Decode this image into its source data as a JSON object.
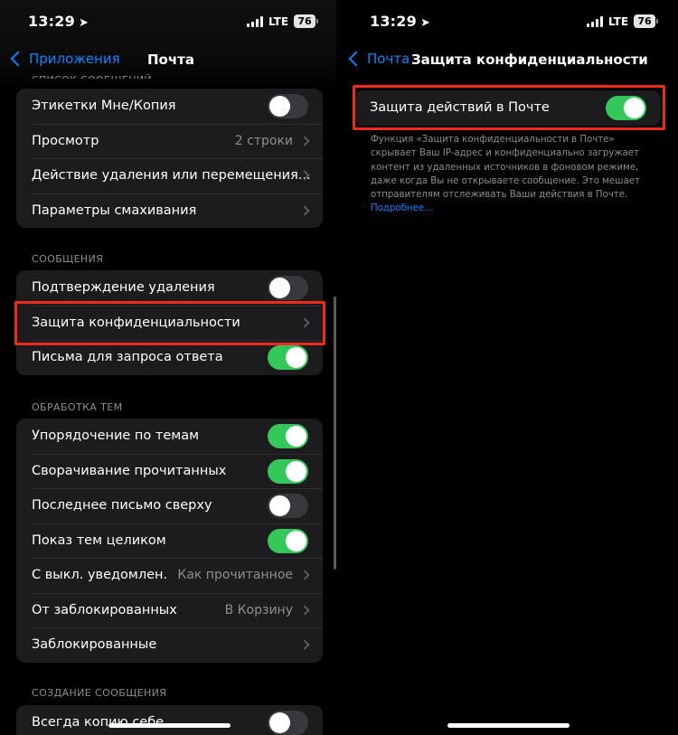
{
  "left": {
    "status": {
      "time": "13:29",
      "network": "LTE",
      "battery": "76"
    },
    "nav": {
      "back_label": "Приложения",
      "title": "Почта"
    },
    "cut_header": "СПИСОК СООБЩЕНИЙ",
    "list_group": [
      {
        "label": "Этикетки Мне/Копия",
        "toggle": false
      },
      {
        "label": "Просмотр",
        "value": "2 строки"
      },
      {
        "label": "Действие удаления или перемещения..."
      },
      {
        "label": "Параметры смахивания"
      }
    ],
    "messages_header": "СООБЩЕНИЯ",
    "messages_group": [
      {
        "label": "Подтверждение удаления",
        "toggle": false
      },
      {
        "label": "Защита конфиденциальности"
      },
      {
        "label": "Письма для запроса ответа",
        "toggle": true
      }
    ],
    "threads_header": "ОБРАБОТКА ТЕМ",
    "threads_group": [
      {
        "label": "Упорядочение по темам",
        "toggle": true
      },
      {
        "label": "Сворачивание прочитанных",
        "toggle": true
      },
      {
        "label": "Последнее письмо сверху",
        "toggle": false
      },
      {
        "label": "Показ тем целиком",
        "toggle": true
      },
      {
        "label": "С выкл. уведомлен.",
        "value": "Как прочитанное"
      },
      {
        "label": "От заблокированных",
        "value": "В Корзину"
      },
      {
        "label": "Заблокированные"
      }
    ],
    "compose_header": "СОЗДАНИЕ СООБЩЕНИЯ",
    "compose_group": [
      {
        "label": "Всегда копию себе",
        "toggle": false
      }
    ]
  },
  "right": {
    "status": {
      "time": "13:29",
      "network": "LTE",
      "battery": "76"
    },
    "nav": {
      "back_label": "Почта",
      "title": "Защита конфиденциальности"
    },
    "protect": {
      "label": "Защита действий в Почте",
      "toggle": true
    },
    "description": "Функция «Защита конфиденциальности в Почте» скрывает Ваш IP-адрес и конфиденциально загружает контент из удаленных источников в фоновом режиме, даже когда Вы не открываете сообщение. Это мешает отправителям отслеживать Ваши действия в Почте.",
    "learn_more": "Подробнее…"
  },
  "colors": {
    "accent": "#0a84ff",
    "toggle_on": "#34c759",
    "highlight": "#ef2b1d",
    "cell_bg": "#1c1c1e"
  }
}
